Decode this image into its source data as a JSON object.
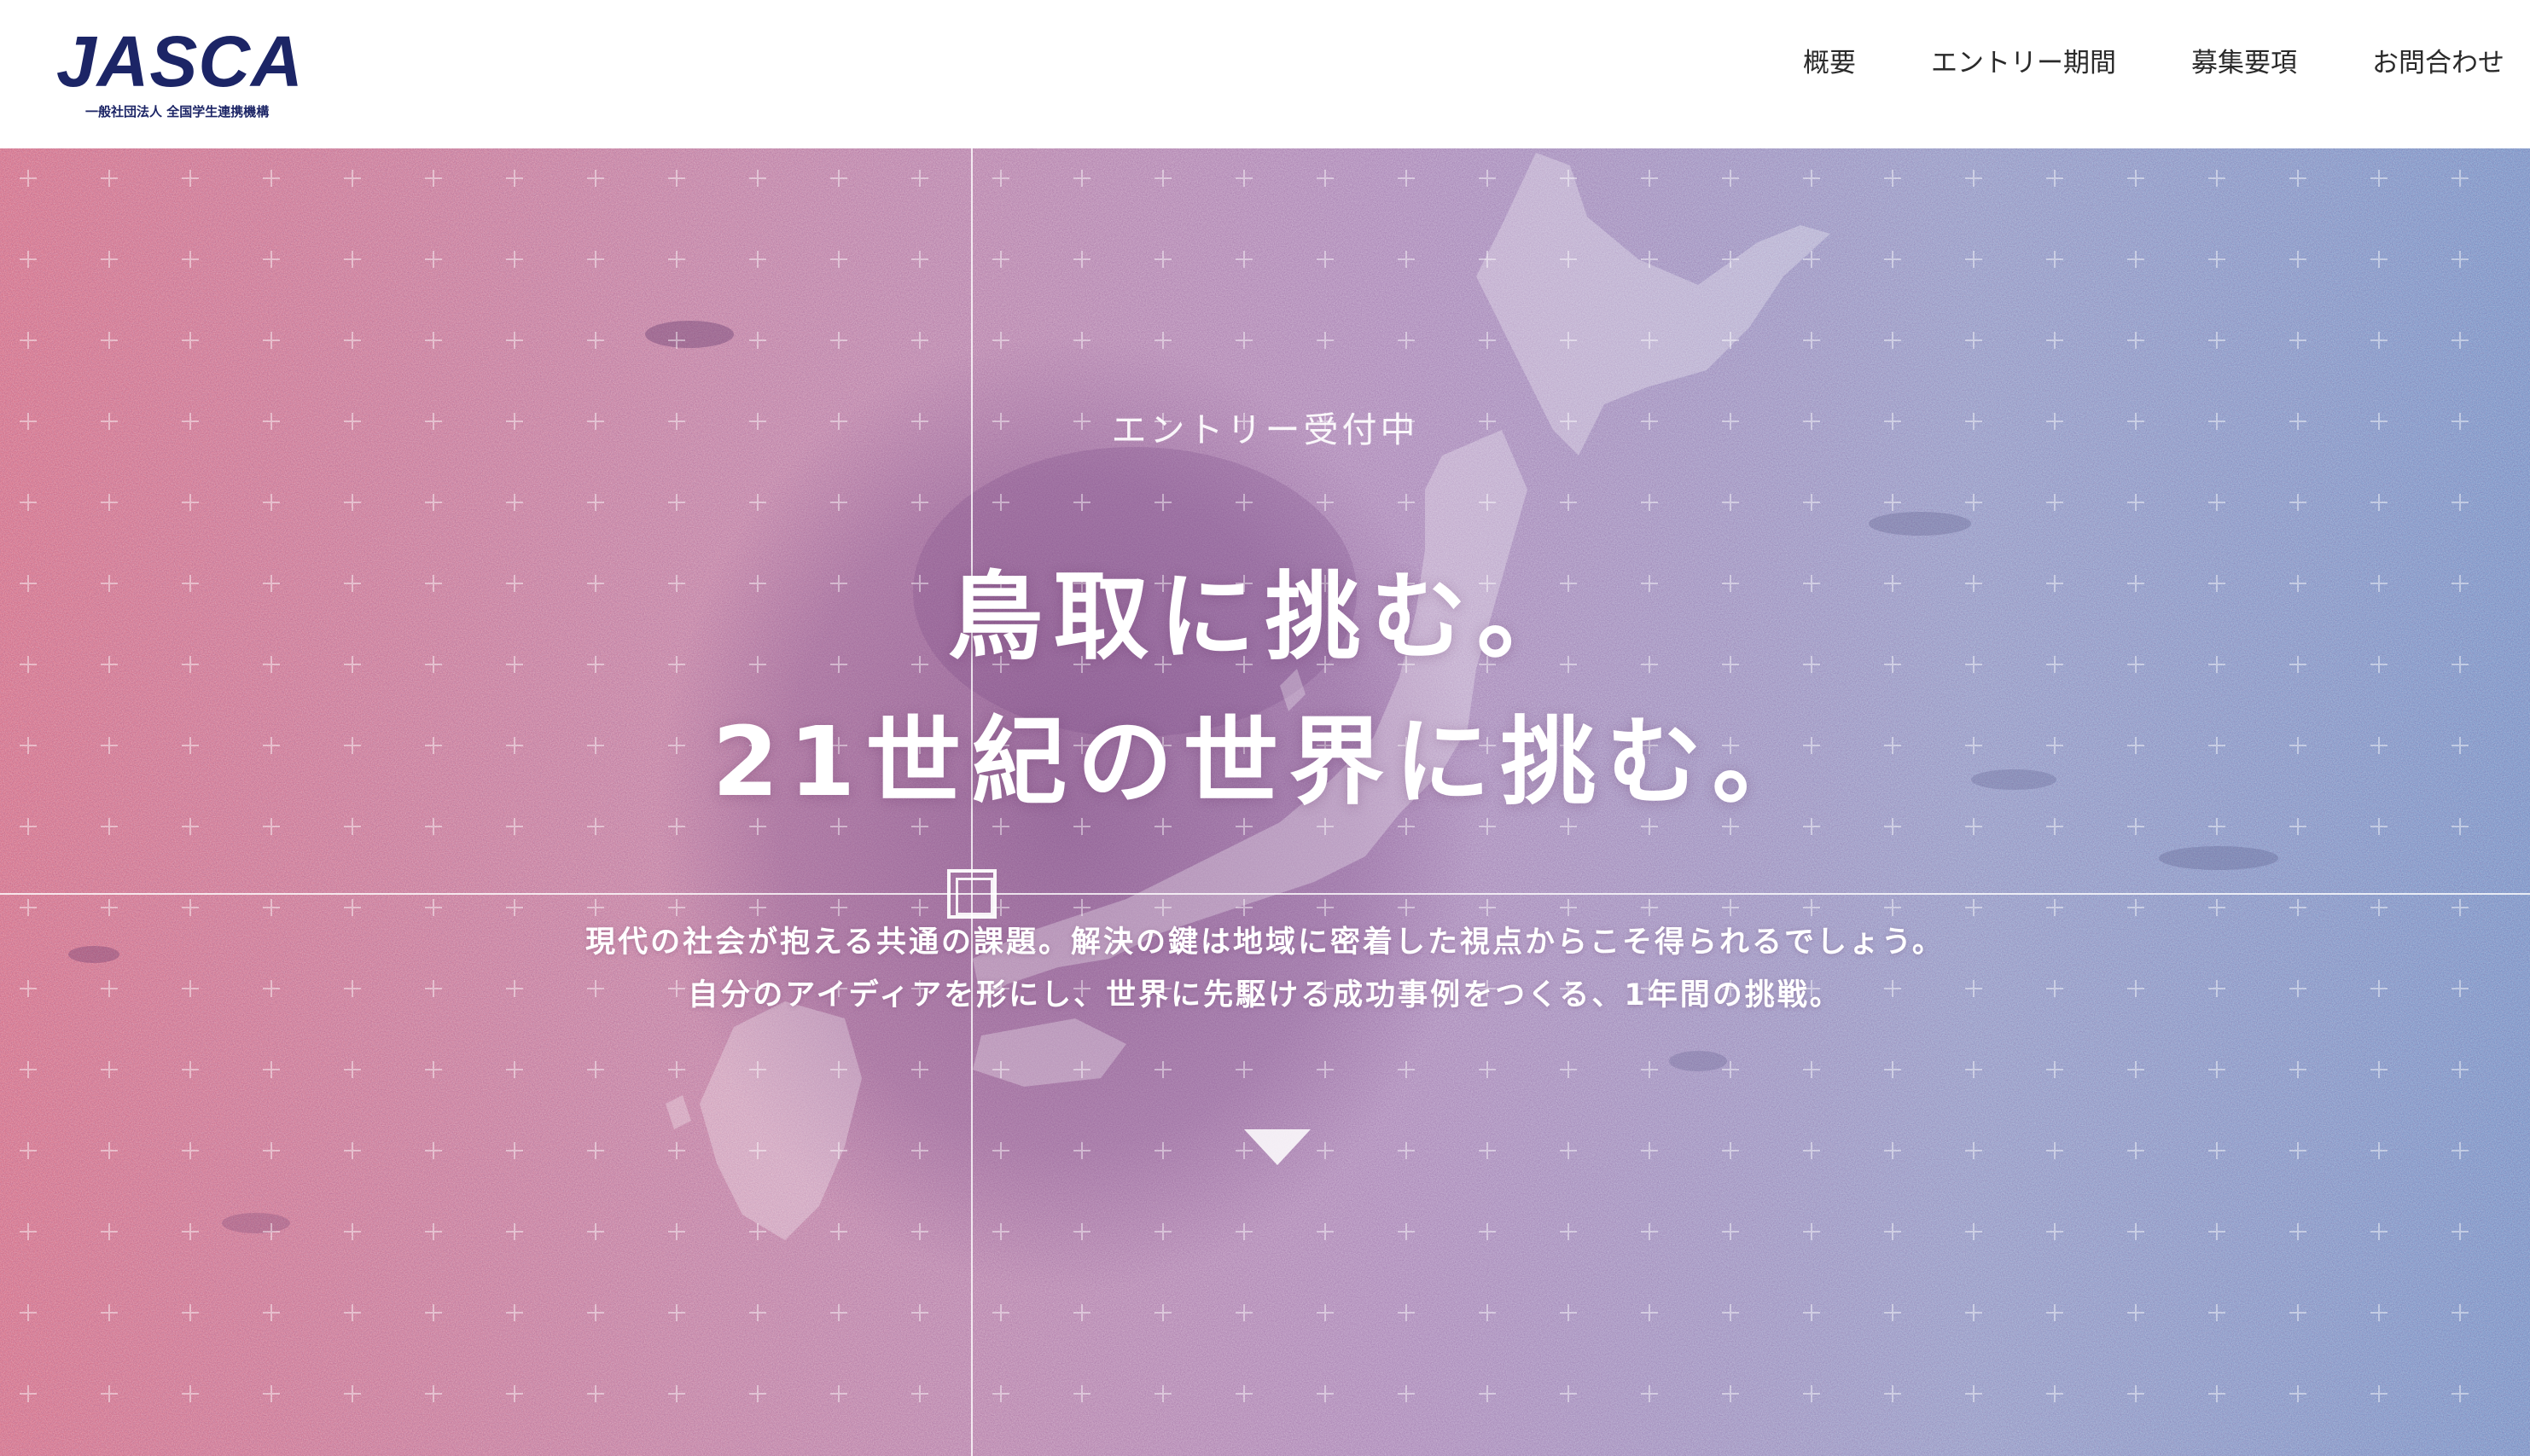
{
  "header": {
    "logo": {
      "word": "JASCA",
      "sub": "一般社団法人 全国学生連携機構",
      "color": "#1c2566"
    },
    "nav": [
      {
        "label": "概要"
      },
      {
        "label": "エントリー期間"
      },
      {
        "label": "募集要項"
      },
      {
        "label": "お問合わせ"
      }
    ]
  },
  "hero": {
    "status": "エントリー受付中",
    "title_line1": "鳥取に挑む。",
    "title_line2": "21世紀の世界に挑む。",
    "desc_line1": "現代の社会が抱える共通の課題。解決の鍵は地域に密着した視点からこそ得られるでしょう。",
    "desc_line2": "自分のアイディアを形にし、世界に先駆ける成功事例をつくる、1年間の挑戦。",
    "scroll_icon": "triangle-down-icon",
    "gradient": [
      "#d9788f",
      "#b494c0",
      "#7f9acb"
    ]
  }
}
